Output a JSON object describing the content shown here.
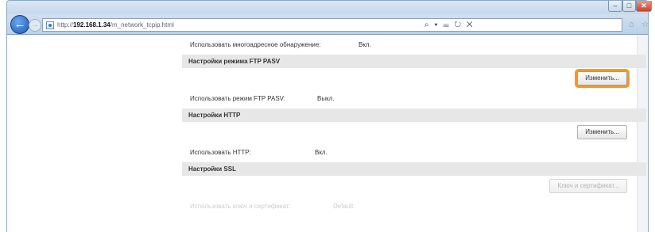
{
  "browser": {
    "url_prefix": "http://",
    "url_host": "192.168.1.34",
    "url_path": "/m_network_tcpip.html",
    "address_tools": "⌕ ▾ ☰ ↻ ✕",
    "right_icons": "⌂ ☆ ⚙",
    "win_min": "–",
    "win_max": "□",
    "win_close": "✕",
    "back": "←",
    "forward": "→"
  },
  "settings": {
    "multicast": {
      "label": "Использовать многоадресное обнаружение:",
      "value": "Вкл."
    },
    "ftp_section": "Настройки режима FTP PASV",
    "ftp_button": "Изменить...",
    "ftp_row": {
      "label": "Использовать режим FTP PASV:",
      "value": "Выкл."
    },
    "http_section": "Настройки HTTP",
    "http_button": "Изменить...",
    "http_row": {
      "label": "Использовать HTTP:",
      "value": "Вкл."
    },
    "ssl_section": "Настройки SSL",
    "ssl_button": "Ключ и сертификат...",
    "ssl_row": {
      "label": "Использовать ключ и сертификат:",
      "value": "Default"
    }
  },
  "colors": {
    "highlight": "#f59a20",
    "section_bg": "#e7e7e7",
    "back_button": "#1d58b3"
  }
}
